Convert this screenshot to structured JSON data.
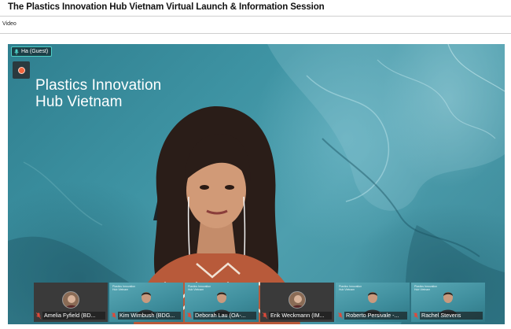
{
  "header": {
    "title": "The Plastics Innovation Hub Vietnam Virtual Launch & Information Session",
    "section_label": "Video"
  },
  "video": {
    "brand_line1": "Plastics Innovation",
    "brand_line2": "Hub Vietnam",
    "speaker_tag": "Ha (Guest)",
    "record_icon": "record-icon",
    "mini_brand_line1": "Plastics Innovation",
    "mini_brand_line2": "Hub Vietnam"
  },
  "participants": [
    {
      "name": "Amelia Fyfield (BD...",
      "mic": "mic-off-icon"
    },
    {
      "name": "Kim Wimbush (BDG...",
      "mic": "mic-off-icon"
    },
    {
      "name": "Deborah Lau (OA-...",
      "mic": "mic-off-icon"
    },
    {
      "name": "Erik Weckmann (IM...",
      "mic": "mic-off-icon"
    },
    {
      "name": "Roberto Persivale -...",
      "mic": "mic-off-icon"
    },
    {
      "name": "Rachel Stevens",
      "mic": "mic-off-icon"
    }
  ],
  "colors": {
    "accent": "#4fd0c7",
    "record": "#f0653d",
    "stage": "#3c8a99"
  }
}
